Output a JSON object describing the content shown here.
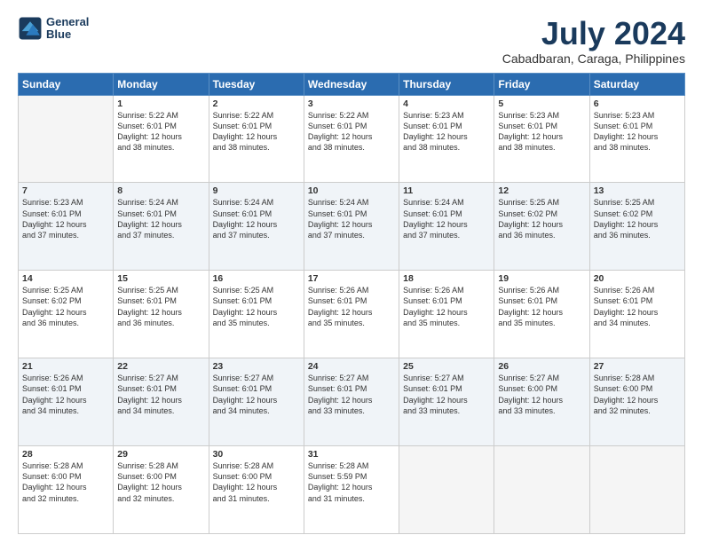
{
  "header": {
    "logo": {
      "line1": "General",
      "line2": "Blue"
    },
    "title": "July 2024",
    "subtitle": "Cabadbaran, Caraga, Philippines"
  },
  "weekdays": [
    "Sunday",
    "Monday",
    "Tuesday",
    "Wednesday",
    "Thursday",
    "Friday",
    "Saturday"
  ],
  "rows": [
    [
      {
        "day": "",
        "info": ""
      },
      {
        "day": "1",
        "info": "Sunrise: 5:22 AM\nSunset: 6:01 PM\nDaylight: 12 hours\nand 38 minutes."
      },
      {
        "day": "2",
        "info": "Sunrise: 5:22 AM\nSunset: 6:01 PM\nDaylight: 12 hours\nand 38 minutes."
      },
      {
        "day": "3",
        "info": "Sunrise: 5:22 AM\nSunset: 6:01 PM\nDaylight: 12 hours\nand 38 minutes."
      },
      {
        "day": "4",
        "info": "Sunrise: 5:23 AM\nSunset: 6:01 PM\nDaylight: 12 hours\nand 38 minutes."
      },
      {
        "day": "5",
        "info": "Sunrise: 5:23 AM\nSunset: 6:01 PM\nDaylight: 12 hours\nand 38 minutes."
      },
      {
        "day": "6",
        "info": "Sunrise: 5:23 AM\nSunset: 6:01 PM\nDaylight: 12 hours\nand 38 minutes."
      }
    ],
    [
      {
        "day": "7",
        "info": "Sunrise: 5:23 AM\nSunset: 6:01 PM\nDaylight: 12 hours\nand 37 minutes."
      },
      {
        "day": "8",
        "info": "Sunrise: 5:24 AM\nSunset: 6:01 PM\nDaylight: 12 hours\nand 37 minutes."
      },
      {
        "day": "9",
        "info": "Sunrise: 5:24 AM\nSunset: 6:01 PM\nDaylight: 12 hours\nand 37 minutes."
      },
      {
        "day": "10",
        "info": "Sunrise: 5:24 AM\nSunset: 6:01 PM\nDaylight: 12 hours\nand 37 minutes."
      },
      {
        "day": "11",
        "info": "Sunrise: 5:24 AM\nSunset: 6:01 PM\nDaylight: 12 hours\nand 37 minutes."
      },
      {
        "day": "12",
        "info": "Sunrise: 5:25 AM\nSunset: 6:02 PM\nDaylight: 12 hours\nand 36 minutes."
      },
      {
        "day": "13",
        "info": "Sunrise: 5:25 AM\nSunset: 6:02 PM\nDaylight: 12 hours\nand 36 minutes."
      }
    ],
    [
      {
        "day": "14",
        "info": "Sunrise: 5:25 AM\nSunset: 6:02 PM\nDaylight: 12 hours\nand 36 minutes."
      },
      {
        "day": "15",
        "info": "Sunrise: 5:25 AM\nSunset: 6:01 PM\nDaylight: 12 hours\nand 36 minutes."
      },
      {
        "day": "16",
        "info": "Sunrise: 5:25 AM\nSunset: 6:01 PM\nDaylight: 12 hours\nand 35 minutes."
      },
      {
        "day": "17",
        "info": "Sunrise: 5:26 AM\nSunset: 6:01 PM\nDaylight: 12 hours\nand 35 minutes."
      },
      {
        "day": "18",
        "info": "Sunrise: 5:26 AM\nSunset: 6:01 PM\nDaylight: 12 hours\nand 35 minutes."
      },
      {
        "day": "19",
        "info": "Sunrise: 5:26 AM\nSunset: 6:01 PM\nDaylight: 12 hours\nand 35 minutes."
      },
      {
        "day": "20",
        "info": "Sunrise: 5:26 AM\nSunset: 6:01 PM\nDaylight: 12 hours\nand 34 minutes."
      }
    ],
    [
      {
        "day": "21",
        "info": "Sunrise: 5:26 AM\nSunset: 6:01 PM\nDaylight: 12 hours\nand 34 minutes."
      },
      {
        "day": "22",
        "info": "Sunrise: 5:27 AM\nSunset: 6:01 PM\nDaylight: 12 hours\nand 34 minutes."
      },
      {
        "day": "23",
        "info": "Sunrise: 5:27 AM\nSunset: 6:01 PM\nDaylight: 12 hours\nand 34 minutes."
      },
      {
        "day": "24",
        "info": "Sunrise: 5:27 AM\nSunset: 6:01 PM\nDaylight: 12 hours\nand 33 minutes."
      },
      {
        "day": "25",
        "info": "Sunrise: 5:27 AM\nSunset: 6:01 PM\nDaylight: 12 hours\nand 33 minutes."
      },
      {
        "day": "26",
        "info": "Sunrise: 5:27 AM\nSunset: 6:00 PM\nDaylight: 12 hours\nand 33 minutes."
      },
      {
        "day": "27",
        "info": "Sunrise: 5:28 AM\nSunset: 6:00 PM\nDaylight: 12 hours\nand 32 minutes."
      }
    ],
    [
      {
        "day": "28",
        "info": "Sunrise: 5:28 AM\nSunset: 6:00 PM\nDaylight: 12 hours\nand 32 minutes."
      },
      {
        "day": "29",
        "info": "Sunrise: 5:28 AM\nSunset: 6:00 PM\nDaylight: 12 hours\nand 32 minutes."
      },
      {
        "day": "30",
        "info": "Sunrise: 5:28 AM\nSunset: 6:00 PM\nDaylight: 12 hours\nand 31 minutes."
      },
      {
        "day": "31",
        "info": "Sunrise: 5:28 AM\nSunset: 5:59 PM\nDaylight: 12 hours\nand 31 minutes."
      },
      {
        "day": "",
        "info": ""
      },
      {
        "day": "",
        "info": ""
      },
      {
        "day": "",
        "info": ""
      }
    ]
  ]
}
